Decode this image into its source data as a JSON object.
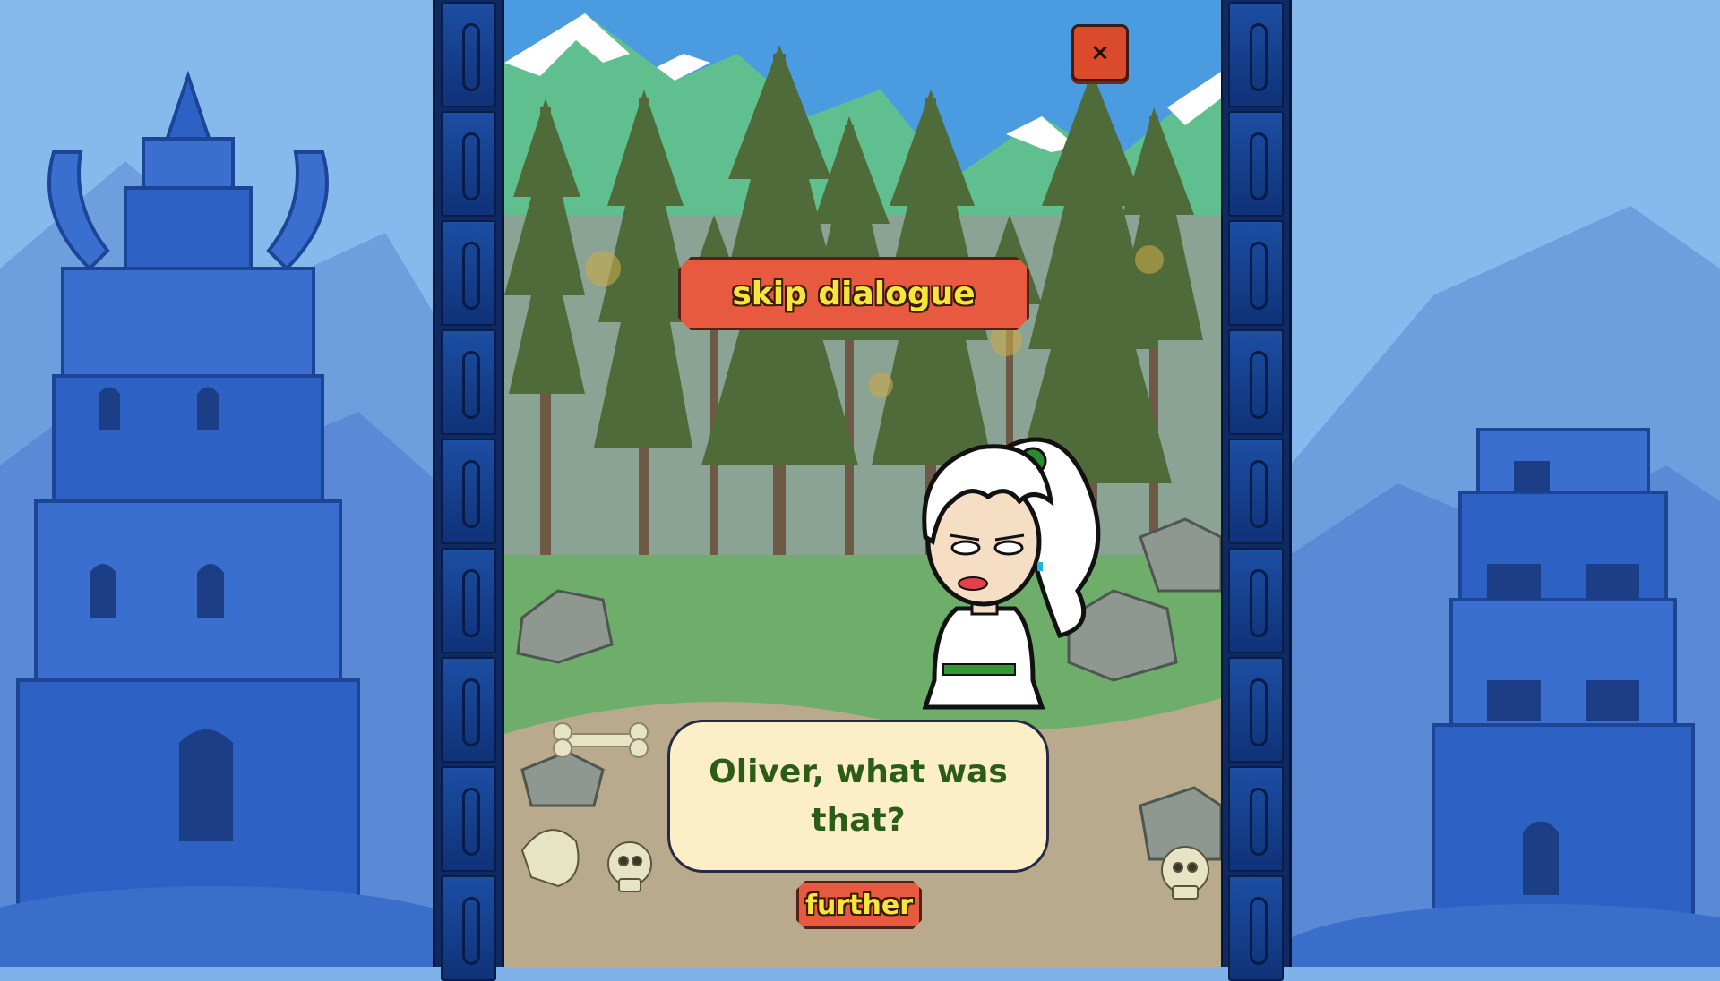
{
  "game": {
    "skip_label": "skip dialogue",
    "dialogue_text": "Oliver, what was that?",
    "further_label": "further",
    "close_symbol": "×"
  },
  "icons": {
    "close": "close-icon"
  },
  "colors": {
    "button_fill": "#e75a40",
    "button_text": "#f6e63a",
    "dialogue_bg": "#fcefc7",
    "dialogue_text": "#2c5d17",
    "side_bg": "#7fb2e8",
    "tower": "#2d62c4",
    "border": "#0f2a63"
  }
}
